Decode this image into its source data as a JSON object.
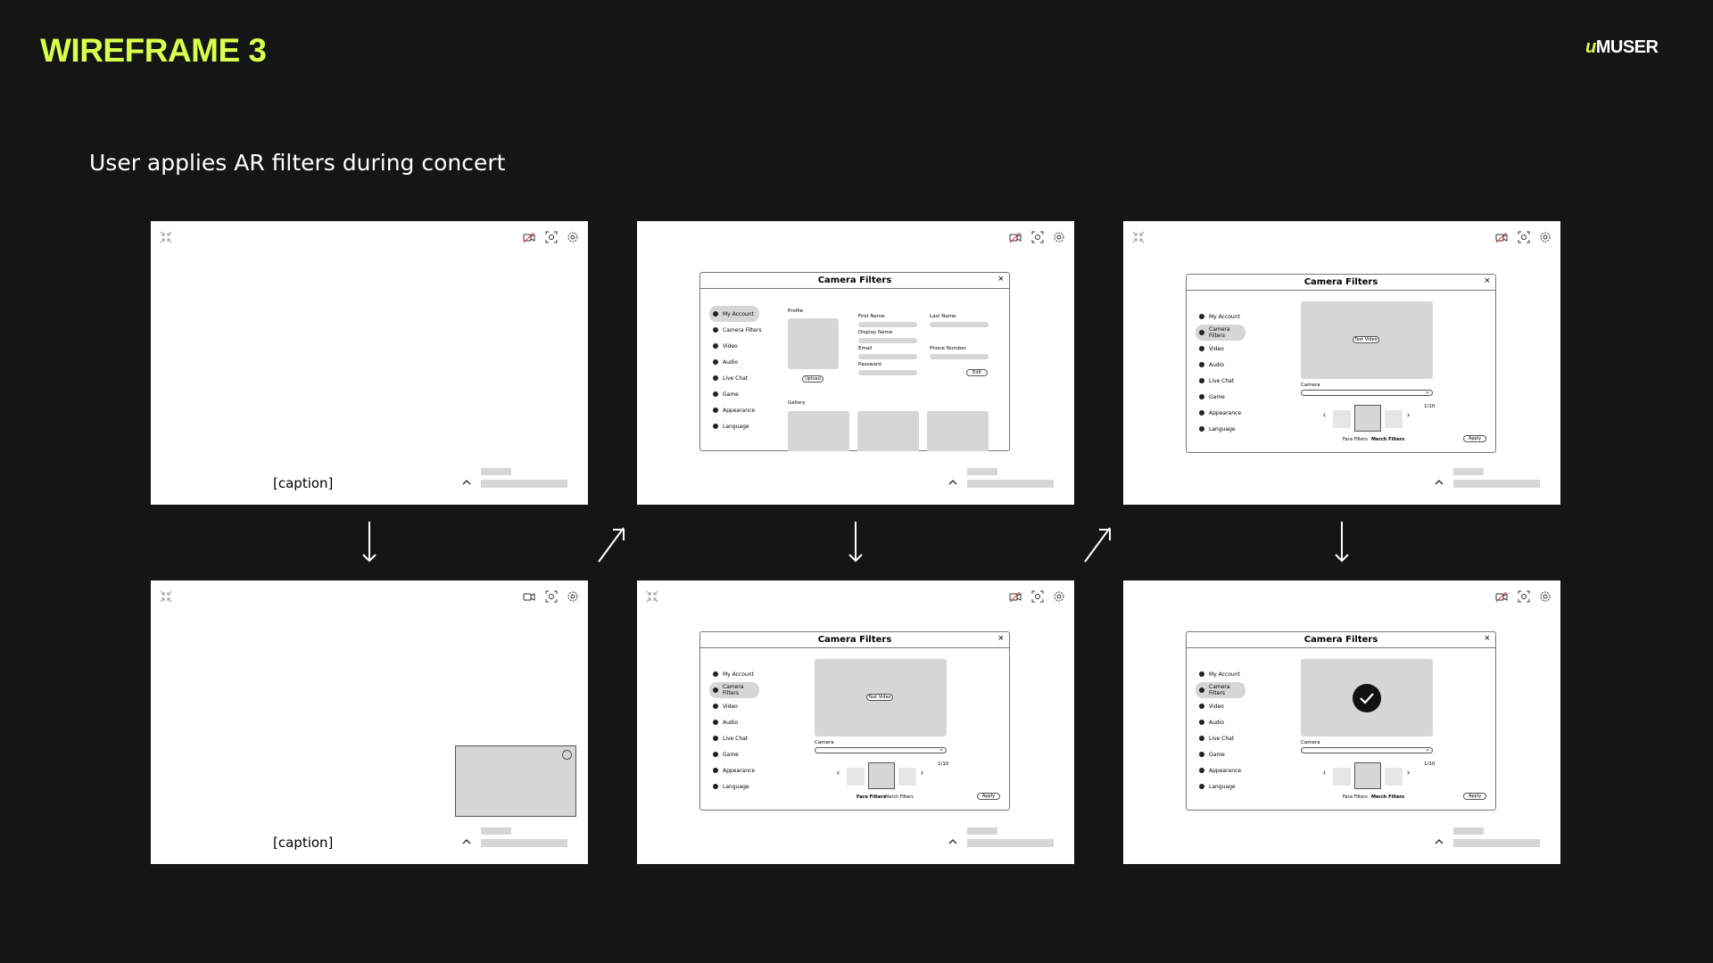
{
  "header": {
    "title": "WIREFRAME 3",
    "logo_mark": "u",
    "logo_text": "MUSER"
  },
  "subtitle": "User applies AR filters during concert",
  "frames": {
    "f1": {
      "caption": "[caption]"
    },
    "f4": {
      "caption": "[caption]"
    }
  },
  "modal": {
    "title": "Camera Filters",
    "close": "×",
    "sidebar": [
      "My Account",
      "Camera Filters",
      "Video",
      "Audio",
      "Live Chat",
      "Game",
      "Appearance",
      "Language"
    ],
    "profile": {
      "section": "Profile",
      "upload": "Upload",
      "first_name": "First Name",
      "last_name": "Last Name",
      "display_name": "Display Name",
      "email": "Email",
      "phone": "Phone Number",
      "password": "Password",
      "edit": "Edit",
      "gallery": "Gallery"
    },
    "filters": {
      "test_video": "Test Video",
      "camera": "Camera",
      "count": "1/10",
      "face_tab": "Face Filters",
      "merch_tab": "Merch Filters",
      "apply": "Apply"
    }
  },
  "icons": [
    "collapse-icon",
    "camera-off-icon",
    "camera-icon",
    "screenshot-icon",
    "gear-icon",
    "chevron-up-icon",
    "arrow-down-icon",
    "arrow-up-right-icon",
    "check-icon"
  ],
  "colors": {
    "accent": "#d9ff4d",
    "background": "#151515",
    "placeholder": "#d6d6d6"
  }
}
